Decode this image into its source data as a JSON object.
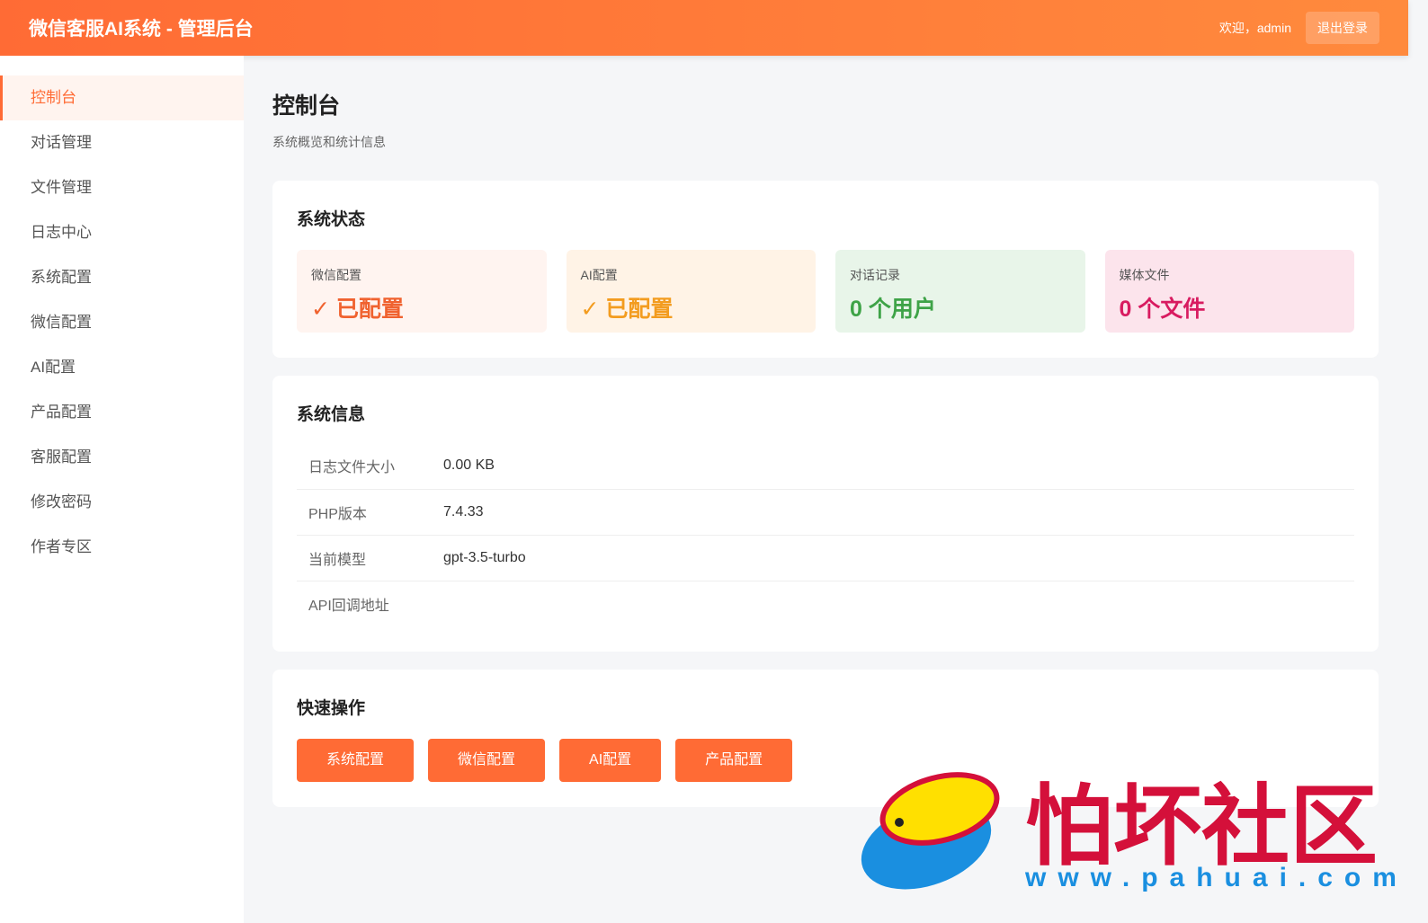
{
  "header": {
    "title": "微信客服AI系统 - 管理后台",
    "welcome": "欢迎，admin",
    "logout": "退出登录"
  },
  "sidebar": {
    "items": [
      {
        "label": "控制台"
      },
      {
        "label": "对话管理"
      },
      {
        "label": "文件管理"
      },
      {
        "label": "日志中心"
      },
      {
        "label": "系统配置"
      },
      {
        "label": "微信配置"
      },
      {
        "label": "AI配置"
      },
      {
        "label": "产品配置"
      },
      {
        "label": "客服配置"
      },
      {
        "label": "修改密码"
      },
      {
        "label": "作者专区"
      }
    ]
  },
  "page": {
    "title": "控制台",
    "subtitle": "系统概览和统计信息"
  },
  "status": {
    "title": "系统状态",
    "cards": [
      {
        "label": "微信配置",
        "value": "✓ 已配置",
        "color": "#f0622f",
        "bg": "#fff4f0"
      },
      {
        "label": "AI配置",
        "value": "✓ 已配置",
        "color": "#f39c1f",
        "bg": "#fff3e6"
      },
      {
        "label": "对话记录",
        "value": "0 个用户",
        "color": "#3ea347",
        "bg": "#e8f5e9"
      },
      {
        "label": "媒体文件",
        "value": "0 个文件",
        "color": "#d81b60",
        "bg": "#fce4ec"
      }
    ]
  },
  "info": {
    "title": "系统信息",
    "rows": [
      {
        "key": "日志文件大小",
        "value": "0.00 KB"
      },
      {
        "key": "PHP版本",
        "value": "7.4.33"
      },
      {
        "key": "当前模型",
        "value": "gpt-3.5-turbo"
      },
      {
        "key": "API回调地址",
        "value": ""
      }
    ]
  },
  "quick": {
    "title": "快速操作",
    "buttons": [
      "系统配置",
      "微信配置",
      "AI配置",
      "产品配置"
    ]
  },
  "watermark": {
    "text": "怕坏社区",
    "url": "www.pahuai.com"
  }
}
